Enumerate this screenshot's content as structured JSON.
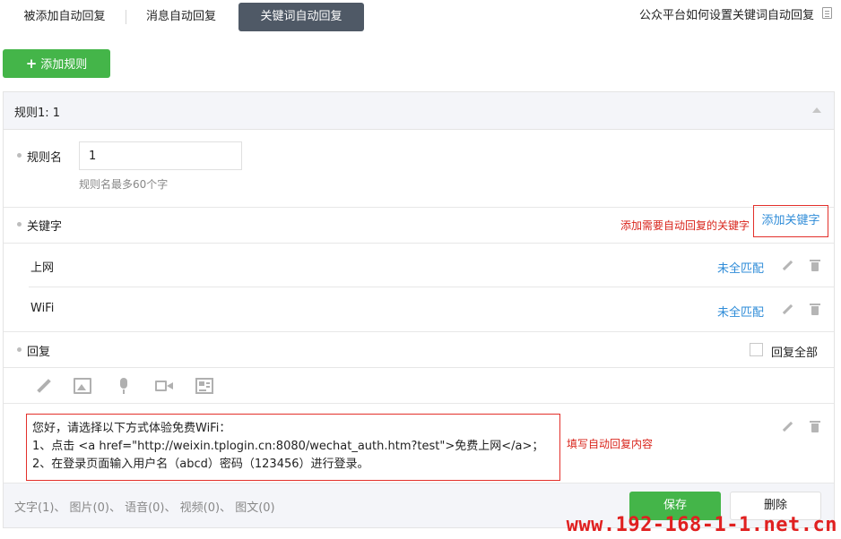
{
  "tabs": [
    {
      "label": "被添加自动回复"
    },
    {
      "label": "消息自动回复"
    },
    {
      "label": "关键词自动回复",
      "active": true
    }
  ],
  "help_link": "公众平台如何设置关键词自动回复",
  "add_rule_button": "添加规则",
  "rule": {
    "title": "规则1: 1",
    "name_label": "规则名",
    "name_value": "1",
    "name_tip": "规则名最多60个字",
    "keyword_label": "关键字",
    "keyword_annotation": "添加需要自动回复的关键字",
    "add_keyword_link": "添加关键字",
    "keywords": [
      {
        "text": "上网",
        "match": "未全匹配"
      },
      {
        "text": "WiFi",
        "match": "未全匹配"
      }
    ],
    "reply_label": "回复",
    "reply_all_label": "回复全部",
    "reply_all_checked": false,
    "media_icons": [
      "pencil-icon",
      "image-icon",
      "microphone-icon",
      "video-icon",
      "news-icon"
    ],
    "reply_content": [
      "您好，请选择以下方式体验免费WiFi：",
      "1、点击 <a href=\"http://weixin.tplogin.cn:8080/wechat_auth.htm?test\">免费上网</a>；",
      "2、在登录页面输入用户名（abcd）密码（123456）进行登录。"
    ],
    "reply_annotation": "填写自动回复内容",
    "counts": "文字(1)、 图片(0)、 语音(0)、 视频(0)、 图文(0)",
    "save_button": "保存",
    "delete_button": "删除"
  },
  "watermark": "www.192-168-1-1.net.cn",
  "colors": {
    "active_tab_bg": "#4f5966",
    "primary_green": "#44b549",
    "link_blue": "#2f8cd8",
    "annotation_red": "#d9251c",
    "panel_header_bg": "#f4f5f9"
  }
}
